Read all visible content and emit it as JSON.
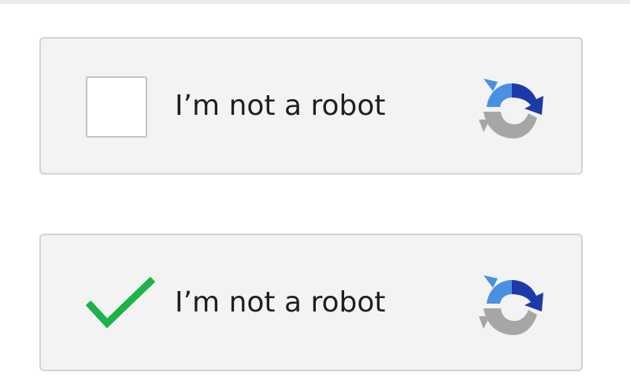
{
  "captchas": [
    {
      "label": "I’m not a robot",
      "state": "unchecked",
      "icon": "recaptcha-logo-icon"
    },
    {
      "label": "I’m not a robot",
      "state": "checked",
      "icon": "recaptcha-logo-icon"
    }
  ],
  "colors": {
    "box_background": "#f3f3f3",
    "box_border": "#d3d3d3",
    "checkbox_border": "#c3c3c3",
    "check_green": "#1cb34a",
    "logo_light_blue": "#4a90e2",
    "logo_dark_blue": "#1c3aa9",
    "logo_gray": "#a6a6a6"
  }
}
